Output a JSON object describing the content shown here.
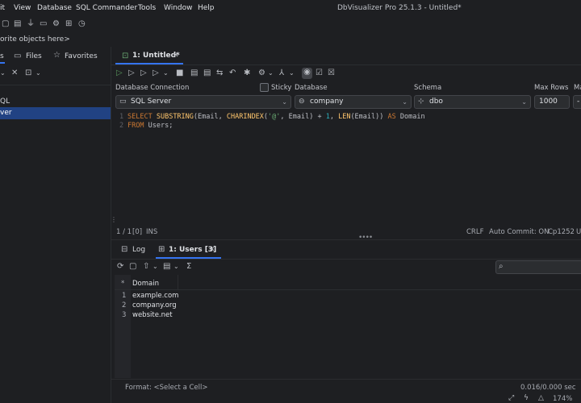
{
  "menu": {
    "items": [
      "it",
      "View",
      "Database",
      "SQL Commander",
      "Tools",
      "Window",
      "Help"
    ],
    "title": "DbVisualizer Pro 25.1.3 - Untitled*"
  },
  "favbar": {
    "text": "orite objects here>"
  },
  "left_tabs": {
    "t0": "s",
    "files": "Files",
    "favorites": "Favorites"
  },
  "tree": {
    "item1": "QL",
    "item2": "ver"
  },
  "editor_tab": {
    "label": "1: Untitled*"
  },
  "connection": {
    "db_conn_label": "Database Connection",
    "sticky_label": "Sticky",
    "database_label": "Database",
    "schema_label": "Schema",
    "maxrows_label": "Max Rows",
    "maxcol_label": "Ma",
    "db_conn_value": "SQL Server",
    "database_value": "company",
    "schema_value": "dbo",
    "maxrows_value": "1000"
  },
  "code": {
    "line1_num": "1",
    "line2_num": "2",
    "l1_select": "SELECT",
    "l1_substring": "SUBSTRING",
    "l1_a": "(Email, ",
    "l1_charindex": "CHARINDEX",
    "l1_b": "(",
    "l1_at": "'@'",
    "l1_c": ", Email) + ",
    "l1_one": "1",
    "l1_d": ", ",
    "l1_len": "LEN",
    "l1_e": "(Email)) ",
    "l1_as": "AS",
    "l1_domain": " Domain",
    "l2_from": "FROM",
    "l2_users": " Users;"
  },
  "editor_status": {
    "pos": "1 / 1",
    "sel": "[0]",
    "mode": "INS",
    "eol": "CRLF",
    "autocommit": "Auto Commit: ON",
    "encoding": "Cp1252",
    "extra": "U"
  },
  "result_tabs": {
    "log": "Log",
    "users": "1: Users [3]"
  },
  "grid": {
    "star": "*",
    "column": "Domain",
    "rows": [
      {
        "num": "1",
        "value": "example.com"
      },
      {
        "num": "2",
        "value": "company.org"
      },
      {
        "num": "3",
        "value": "website.net"
      }
    ]
  },
  "bottom_status": {
    "format": "Format: <Select a Cell>",
    "time": "0.016/0.000 sec",
    "zoom": "174%"
  },
  "colors": {
    "selection": "#214283",
    "accent": "#3574f0"
  }
}
